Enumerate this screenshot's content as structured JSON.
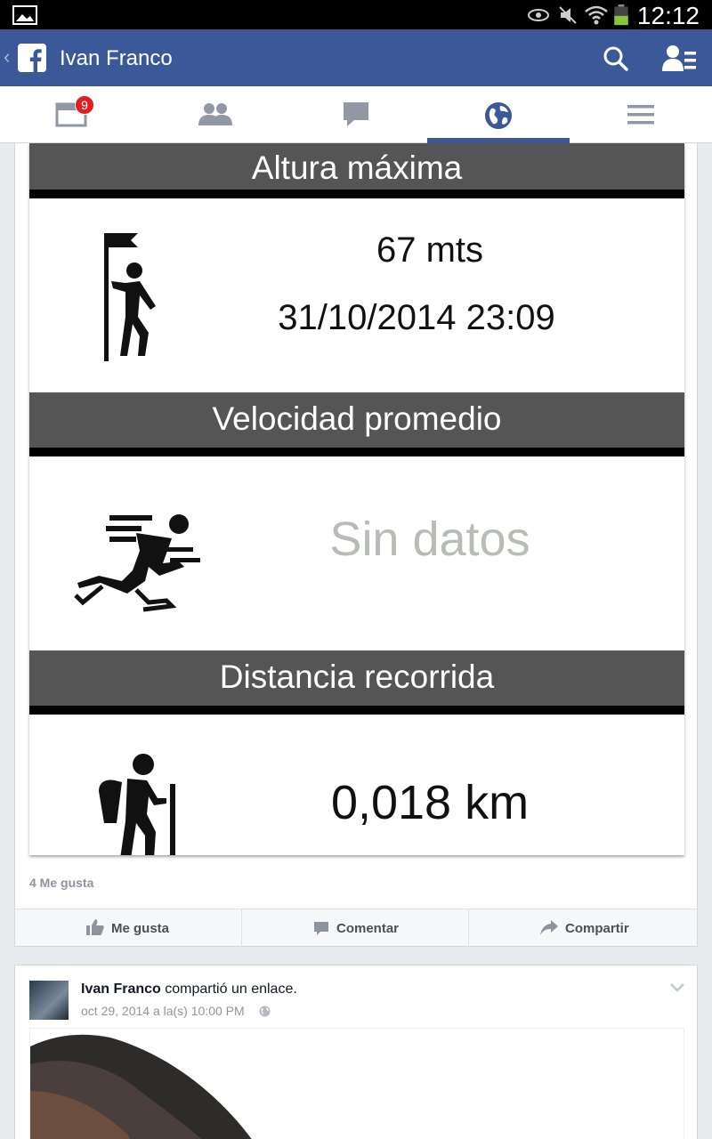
{
  "status_bar": {
    "time": "12:12"
  },
  "header": {
    "title": "Ivan Franco"
  },
  "tabs": {
    "news_badge": "9"
  },
  "post1": {
    "sections": [
      {
        "heading": "Altura máxima",
        "values": [
          "67 mts",
          "31/10/2014 23:09"
        ]
      },
      {
        "heading": "Velocidad promedio",
        "values": [
          "Sin datos"
        ]
      },
      {
        "heading": "Distancia recorrida",
        "values": [
          "0,018 km"
        ]
      }
    ],
    "likes": "4 Me gusta",
    "actions": {
      "like": "Me gusta",
      "comment": "Comentar",
      "share": "Compartir"
    }
  },
  "post2": {
    "author": "Ivan Franco",
    "action_text": " compartió un enlace.",
    "date": "oct 29, 2014 a la(s) 10:00 PM"
  }
}
